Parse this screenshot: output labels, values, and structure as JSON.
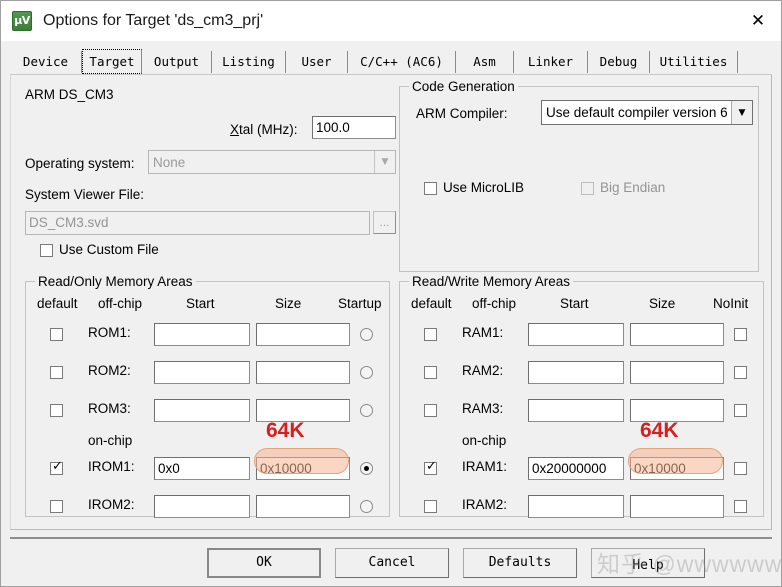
{
  "window": {
    "title": "Options for Target 'ds_cm3_prj'",
    "app_icon": "uvision-icon",
    "close_label": "✕"
  },
  "tabs": [
    {
      "label": "Device",
      "selected": false
    },
    {
      "label": "Target",
      "selected": true
    },
    {
      "label": "Output",
      "selected": false
    },
    {
      "label": "Listing",
      "selected": false
    },
    {
      "label": "User",
      "selected": false
    },
    {
      "label": "C/C++ (AC6)",
      "selected": false
    },
    {
      "label": "Asm",
      "selected": false
    },
    {
      "label": "Linker",
      "selected": false
    },
    {
      "label": "Debug",
      "selected": false
    },
    {
      "label": "Utilities",
      "selected": false
    }
  ],
  "target": {
    "device_name": "ARM DS_CM3",
    "xtal_label_prefix": "X",
    "xtal_label_rest": "tal (MHz):",
    "xtal_value": "100.0",
    "os_label": "Operating system:",
    "os_value": "None",
    "svf_label": "System Viewer File:",
    "svf_value": "DS_CM3.svd",
    "svf_browse_label": "...",
    "use_custom_file_label": "Use Custom File",
    "use_custom_file_checked": false
  },
  "code_generation": {
    "title": "Code Generation",
    "compiler_label": "ARM Compiler:",
    "compiler_value": "Use default compiler version 6",
    "microlib_label": "Use MicroLIB",
    "microlib_checked": false,
    "big_endian_label": "Big Endian",
    "big_endian_checked": false,
    "big_endian_disabled": true
  },
  "readonly_memory": {
    "title": "Read/Only Memory Areas",
    "headers": {
      "default": "default",
      "offchip": "off-chip",
      "start": "Start",
      "size": "Size",
      "last": "Startup"
    },
    "onchip_label": "on-chip",
    "rows": [
      {
        "name": "ROM1:",
        "checked": false,
        "start": "",
        "size": "",
        "selected": false
      },
      {
        "name": "ROM2:",
        "checked": false,
        "start": "",
        "size": "",
        "selected": false
      },
      {
        "name": "ROM3:",
        "checked": false,
        "start": "",
        "size": "",
        "selected": false
      },
      {
        "name": "IROM1:",
        "checked": true,
        "start": "0x0",
        "size": "0x10000",
        "selected": true
      },
      {
        "name": "IROM2:",
        "checked": false,
        "start": "",
        "size": "",
        "selected": false
      }
    ],
    "annotation": "64K"
  },
  "readwrite_memory": {
    "title": "Read/Write Memory Areas",
    "headers": {
      "default": "default",
      "offchip": "off-chip",
      "start": "Start",
      "size": "Size",
      "last": "NoInit"
    },
    "onchip_label": "on-chip",
    "rows": [
      {
        "name": "RAM1:",
        "checked": false,
        "start": "",
        "size": "",
        "noinit": false
      },
      {
        "name": "RAM2:",
        "checked": false,
        "start": "",
        "size": "",
        "noinit": false
      },
      {
        "name": "RAM3:",
        "checked": false,
        "start": "",
        "size": "",
        "noinit": false
      },
      {
        "name": "IRAM1:",
        "checked": true,
        "start": "0x20000000",
        "size": "0x10000",
        "noinit": false
      },
      {
        "name": "IRAM2:",
        "checked": false,
        "start": "",
        "size": "",
        "noinit": false
      }
    ],
    "annotation": "64K"
  },
  "footer": {
    "ok_label": "OK",
    "cancel_label": "Cancel",
    "defaults_label": "Defaults",
    "help_label": "Help"
  },
  "watermark": {
    "text": "知乎 @wwwwww"
  },
  "colors": {
    "dialog_bg": "#f0f0f0",
    "annotation_red": "#d81f1f",
    "highlight_fill": "#f4b794",
    "highlight_border": "#e8a37c",
    "accent_icon_green": "#3d7d3d"
  }
}
